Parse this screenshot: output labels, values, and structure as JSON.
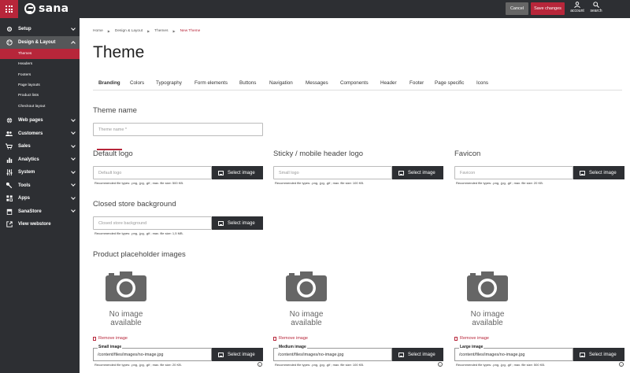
{
  "app": {
    "brand": "sana"
  },
  "toolbar": {
    "cancel": "Cancel",
    "save": "Save changes",
    "account": "account",
    "search": "search"
  },
  "colors": {
    "accent": "#b7263a",
    "sidebar_bg": "#2d2f33",
    "active_group_bg": "#555759"
  },
  "sidebar": {
    "items": [
      {
        "label": "Setup",
        "icon": "gear-icon"
      },
      {
        "label": "Design & Layout",
        "icon": "palette-icon",
        "open": true,
        "children": [
          "Themes",
          "Headers",
          "Footers",
          "Page layouts",
          "Product lists",
          "Checkout layout"
        ],
        "active_child": "Themes"
      },
      {
        "label": "Web pages",
        "icon": "globe-icon"
      },
      {
        "label": "Customers",
        "icon": "users-icon"
      },
      {
        "label": "Sales",
        "icon": "cart-icon"
      },
      {
        "label": "Analytics",
        "icon": "chart-icon"
      },
      {
        "label": "System",
        "icon": "sliders-icon"
      },
      {
        "label": "Tools",
        "icon": "wrench-icon"
      },
      {
        "label": "Apps",
        "icon": "apps-icon"
      },
      {
        "label": "SanaStore",
        "icon": "store-icon"
      },
      {
        "label": "View webstore",
        "icon": "external-link-icon"
      }
    ]
  },
  "breadcrumb": [
    "Home",
    "Design & Layout",
    "Themes",
    "New Theme"
  ],
  "page_title": "Theme",
  "tabs": [
    "Branding",
    "Colors",
    "Typography",
    "Form elements",
    "Buttons",
    "Navigation",
    "Messages",
    "Components",
    "Header",
    "Footer",
    "Page specific",
    "Icons"
  ],
  "active_tab": "Branding",
  "theme_name": {
    "title": "Theme name",
    "placeholder": "Theme name *"
  },
  "select_image_label": "Select image",
  "default_logo": {
    "title": "Default logo",
    "placeholder": "Default logo",
    "hint": "Recommended file types: .png, .jpg, .gif ; max. file size: 500 KB."
  },
  "sticky_logo": {
    "title": "Sticky / mobile header logo",
    "placeholder": "Small logo",
    "hint": "Recommended file types: .png, .jpg, .gif ; max. file size: 100 KB."
  },
  "favicon": {
    "title": "Favicon",
    "placeholder": "Favicon",
    "hint": "Recommended file types: .png, .jpg, .gif ; max. file size: 20 KB."
  },
  "closed_store": {
    "title": "Closed store background",
    "placeholder": "Closed store background",
    "hint": "Recommended file types: .png, .jpg, .gif ; max. file size: 1,5 MB."
  },
  "placeholders": {
    "title": "Product placeholder images",
    "no_image_line1": "No image",
    "no_image_line2": "available",
    "remove_label": "Remove image",
    "items": [
      {
        "label": "Small image",
        "value": "/content/files/images/no-image.jpg",
        "hint": "Recommended file types: .png, .jpg, .gif ; max. file size: 20 KB."
      },
      {
        "label": "Medium image",
        "value": "/content/files/images/no-image.jpg",
        "hint": "Recommended file types: .png, .jpg, .gif ; max. file size: 100 KB."
      },
      {
        "label": "Large image",
        "value": "/content/files/images/no-image.jpg",
        "hint": "Recommended file types: .png, .jpg, .gif ; max. file size: 500 KB."
      }
    ]
  }
}
